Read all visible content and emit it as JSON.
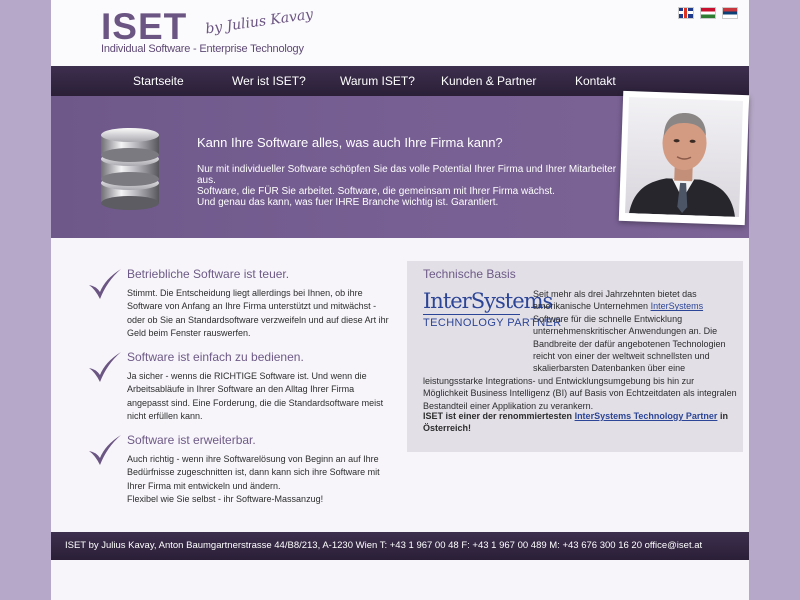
{
  "header": {
    "logo_main": "ISET",
    "logo_by": "by Julius Kavay",
    "logo_tagline": "Individual Software - Enterprise Technology",
    "languages": [
      "English",
      "Magyar",
      "Srpski"
    ]
  },
  "nav": {
    "items": [
      "Startseite",
      "Wer ist ISET?",
      "Warum ISET?",
      "Kunden & Partner",
      "Kontakt"
    ]
  },
  "banner": {
    "title": "Kann Ihre Software alles, was auch Ihre Firma kann?",
    "line1": "Nur mit individueller Software schöpfen Sie das volle Potential Ihrer Firma und Ihrer Mitarbeiter aus.",
    "line2": "Software, die FÜR Sie arbeitet. Software, die gemeinsam mit Ihrer Firma wächst.",
    "line3": "Und genau das kann, was fuer IHRE Branche wichtig ist. Garantiert."
  },
  "features": [
    {
      "title": "Betriebliche Software ist teuer.",
      "text": "Stimmt. Die Entscheidung liegt allerdings bei Ihnen, ob ihre Software von Anfang an Ihre Firma unterstützt und mitwächst - oder ob Sie an Standardsoftware verzweifeln und auf diese Art ihr Geld beim Fenster rauswerfen."
    },
    {
      "title": "Software ist einfach zu bedienen.",
      "text": "Ja sicher - wenns die RICHTIGE Software ist. Und wenn die Arbeitsabläufe in Ihrer Software an den Alltag Ihrer Firma angepasst sind. Eine Forderung, die die Standardsoftware meist nicht erfüllen kann."
    },
    {
      "title": "Software ist erweiterbar.",
      "text": "Auch richtig - wenn ihre Softwarelösung von Beginn an auf Ihre Bedürfnisse zugeschnitten ist, dann kann sich ihre Software mit Ihrer Firma mit entwickeln und ändern.",
      "text2": "Flexibel wie Sie selbst - ihr Software-Massanzug!"
    }
  ],
  "panel": {
    "title": "Technische Basis",
    "logo_big": "InterSystems",
    "logo_small": "TECHNOLOGY PARTNER",
    "text_before": "Seit mehr als drei Jahrzehnten bietet das amerikanische Unternehmen ",
    "link1": "InterSystems",
    "text_after": " Software für die schnelle Entwicklung unternehmenskritischer Anwendungen an. Die Bandbreite der dafür angebotenen Technologien reicht von einer der weltweit schnellsten und skalierbarsten Datenbanken über eine leistungsstarke Integrations- und Entwicklungsumgebung bis hin zur Möglichkeit Business Intelligenz (BI) auf Basis von Echtzeitdaten als integralen Bestandteil einer Applikation zu verankern.",
    "bold_before": "ISET ist einer der renommiertesten ",
    "bold_link": "InterSystems Technology Partner",
    "bold_after": " in Österreich!"
  },
  "footer": {
    "text": "ISET by Julius Kavay, Anton Baumgartnerstrasse 44/B8/213, A-1230 Wien T: +43 1 967 00 48 F: +43 1 967 00 489 M: +43 676 300 16 20 office@iset.at"
  },
  "colors": {
    "background": "#b6a8c8",
    "nav": "#2f2340",
    "banner": "#775f93",
    "accent": "#6d5a86",
    "link": "#2c4596"
  }
}
